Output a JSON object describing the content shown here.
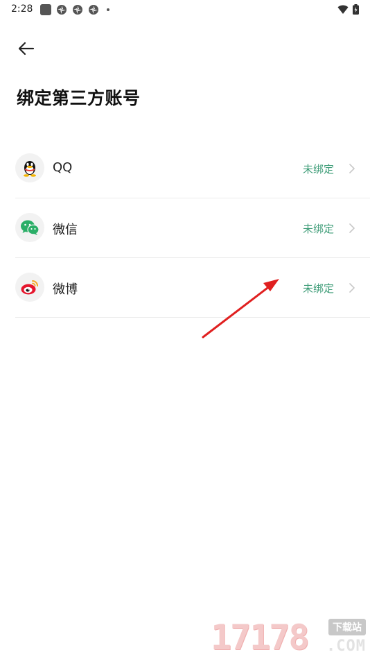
{
  "status_bar": {
    "time": "2:28"
  },
  "page": {
    "title": "绑定第三方账号"
  },
  "accounts": [
    {
      "name": "QQ",
      "status": "未绑定",
      "icon": "qq-icon"
    },
    {
      "name": "微信",
      "status": "未绑定",
      "icon": "wechat-icon"
    },
    {
      "name": "微博",
      "status": "未绑定",
      "icon": "weibo-icon"
    }
  ],
  "watermark": {
    "digits": "17178",
    "tag": "下载站",
    "domain": ".COM"
  },
  "colors": {
    "status_text": "#3d9c77",
    "arrow": "#e02020"
  }
}
